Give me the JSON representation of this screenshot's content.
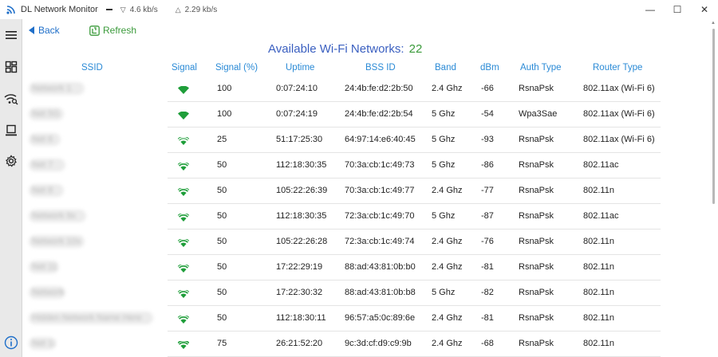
{
  "titlebar": {
    "app_title": "DL Network Monitor",
    "download_speed": "4.6 kb/s",
    "upload_speed": "2.29 kb/s",
    "minimize": "—",
    "maximize": "☐",
    "close": "✕"
  },
  "toolbar": {
    "back_label": "Back",
    "refresh_label": "Refresh"
  },
  "heading": {
    "label": "Available Wi-Fi Networks:",
    "count": "22"
  },
  "table": {
    "columns": [
      "SSID",
      "Signal",
      "Signal (%)",
      "Uptime",
      "BSS ID",
      "Band",
      "dBm",
      "Auth Type",
      "Router Type"
    ],
    "rows": [
      {
        "ssid": "Network 1",
        "signal_pct": "100",
        "uptime": "0:07:24:10",
        "bssid": "24:4b:fe:d2:2b:50",
        "band": "2.4 Ghz",
        "dbm": "-66",
        "auth": "RsnaPsk",
        "router": "802.11ax (Wi-Fi 6)"
      },
      {
        "ssid": "Net 5G",
        "signal_pct": "100",
        "uptime": "0:07:24:19",
        "bssid": "24:4b:fe:d2:2b:54",
        "band": "5 Ghz",
        "dbm": "-54",
        "auth": "Wpa3Sae",
        "router": "802.11ax (Wi-Fi 6)"
      },
      {
        "ssid": "Net 6",
        "signal_pct": "25",
        "uptime": "51:17:25:30",
        "bssid": "64:97:14:e6:40:45",
        "band": "5 Ghz",
        "dbm": "-93",
        "auth": "RsnaPsk",
        "router": "802.11ax (Wi-Fi 6)"
      },
      {
        "ssid": "Net 7",
        "signal_pct": "50",
        "uptime": "112:18:30:35",
        "bssid": "70:3a:cb:1c:49:73",
        "band": "5 Ghz",
        "dbm": "-86",
        "auth": "RsnaPsk",
        "router": "802.11ac"
      },
      {
        "ssid": "Net 8",
        "signal_pct": "50",
        "uptime": "105:22:26:39",
        "bssid": "70:3a:cb:1c:49:77",
        "band": "2.4 Ghz",
        "dbm": "-77",
        "auth": "RsnaPsk",
        "router": "802.11n"
      },
      {
        "ssid": "Network 9x",
        "signal_pct": "50",
        "uptime": "112:18:30:35",
        "bssid": "72:3a:cb:1c:49:70",
        "band": "5 Ghz",
        "dbm": "-87",
        "auth": "RsnaPsk",
        "router": "802.11ac"
      },
      {
        "ssid": "Network 10x",
        "signal_pct": "50",
        "uptime": "105:22:26:28",
        "bssid": "72:3a:cb:1c:49:74",
        "band": "2.4 Ghz",
        "dbm": "-76",
        "auth": "RsnaPsk",
        "router": "802.11n"
      },
      {
        "ssid": "Net 11",
        "signal_pct": "50",
        "uptime": "17:22:29:19",
        "bssid": "88:ad:43:81:0b:b0",
        "band": "2.4 Ghz",
        "dbm": "-81",
        "auth": "RsnaPsk",
        "router": "802.11n"
      },
      {
        "ssid": "Network",
        "signal_pct": "50",
        "uptime": "17:22:30:32",
        "bssid": "88:ad:43:81:0b:b8",
        "band": "5 Ghz",
        "dbm": "-82",
        "auth": "RsnaPsk",
        "router": "802.11n"
      },
      {
        "ssid": "Hidden Network Name Here",
        "signal_pct": "50",
        "uptime": "112:18:30:11",
        "bssid": "96:57:a5:0c:89:6e",
        "band": "2.4 Ghz",
        "dbm": "-81",
        "auth": "RsnaPsk",
        "router": "802.11n"
      },
      {
        "ssid": "Net 13",
        "signal_pct": "75",
        "uptime": "26:21:52:20",
        "bssid": "9c:3d:cf:d9:c9:9b",
        "band": "2.4 Ghz",
        "dbm": "-68",
        "auth": "RsnaPsk",
        "router": "802.11n"
      }
    ]
  },
  "colors": {
    "accent_blue": "#2a8ad6",
    "heading_blue": "#3a5fc0",
    "green": "#3a9a3a",
    "wifi_green": "#1f9e3a"
  },
  "sidebar": {
    "icons": [
      "menu-icon",
      "dashboard-icon",
      "wifi-search-icon",
      "computer-icon",
      "gear-icon",
      "info-icon"
    ]
  }
}
